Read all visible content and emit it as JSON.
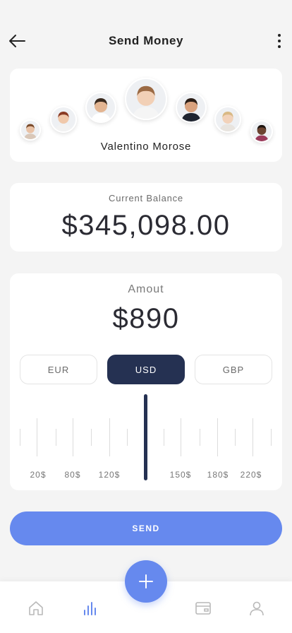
{
  "header": {
    "title": "Send Money",
    "back_icon": "arrow-left-icon",
    "more_icon": "more-vertical-icon"
  },
  "contacts": {
    "selected_name": "Valentino Morose",
    "avatars": [
      {
        "name": "contact-1",
        "skin": "#e9c2a6",
        "hair": "#7a4a2a",
        "shirt": "#d9c7b8"
      },
      {
        "name": "contact-2",
        "skin": "#f0c8aa",
        "hair": "#8a3b24",
        "shirt": "#f2f2f2"
      },
      {
        "name": "contact-3",
        "skin": "#e3b592",
        "hair": "#3a2a1e",
        "shirt": "#ffffff"
      },
      {
        "name": "contact-4",
        "skin": "#f2d0b6",
        "hair": "#9b6a44",
        "shirt": "#f5f5f5"
      },
      {
        "name": "contact-5",
        "skin": "#d9a27e",
        "hair": "#2a1d16",
        "shirt": "#1f2430"
      },
      {
        "name": "contact-6",
        "skin": "#f2d2ba",
        "hair": "#d9b985",
        "shirt": "#e8e4df"
      },
      {
        "name": "contact-7",
        "skin": "#6b4330",
        "hair": "#1c1410",
        "shirt": "#9a3a5a"
      }
    ]
  },
  "balance": {
    "label": "Current Balance",
    "value": "$345,098.00"
  },
  "amount": {
    "label": "Amout",
    "value": "$890",
    "currencies": [
      "EUR",
      "USD",
      "GBP"
    ],
    "selected_currency": "USD",
    "scale_labels": [
      "20$",
      "80$",
      "120$",
      "150$",
      "180$",
      "220$"
    ]
  },
  "send_button": "SEND",
  "colors": {
    "accent": "#6689ee",
    "dark_navy": "#253152"
  },
  "bottom_nav": [
    "home-icon",
    "chart-icon",
    "add-icon",
    "wallet-icon",
    "profile-icon"
  ]
}
